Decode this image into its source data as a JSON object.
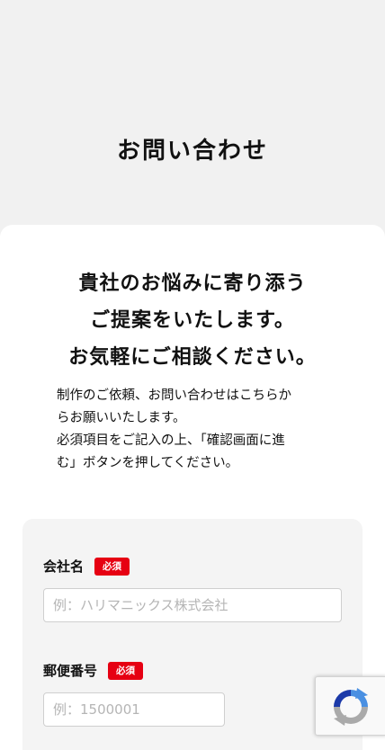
{
  "page": {
    "title": "お問い合わせ"
  },
  "headline": {
    "lines": [
      "貴社のお悩みに寄り添う",
      "ご提案をいたします。",
      "お気軽にご相談ください。"
    ]
  },
  "intro": {
    "lines": [
      "制作のご依頼、お問い合わせはこちらか",
      "らお願いいたします。",
      "必須項目をご記入の上、「確認画面に進",
      "む」ボタンを押してください。"
    ]
  },
  "form": {
    "company": {
      "label": "会社名",
      "required_badge": "必須",
      "value": "",
      "placeholder": "例：ハリマニックス株式会社"
    },
    "postal_code": {
      "label": "郵便番号",
      "required_badge": "必須",
      "value": "",
      "placeholder": "例：1500001"
    }
  },
  "colors": {
    "background": "#f1f1f1",
    "card": "#ffffff",
    "required_badge": "#e60012",
    "recaptcha_blue": "#4a90e2",
    "recaptcha_gray": "#aaaaaa"
  },
  "icons": {
    "recaptcha": "recaptcha-icon"
  }
}
